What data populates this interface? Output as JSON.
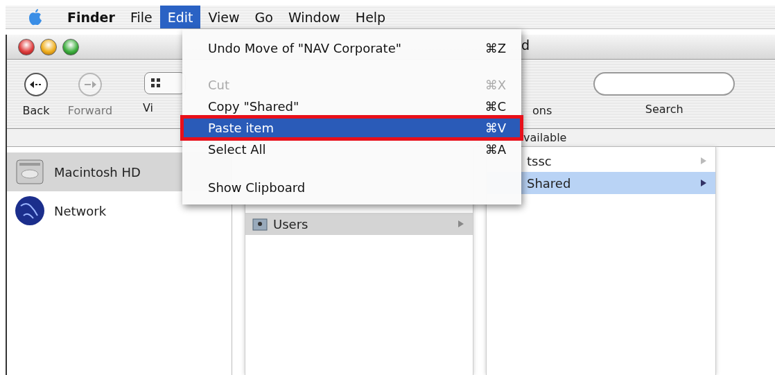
{
  "menu_bar": {
    "items": [
      {
        "label": "Finder",
        "selected": false
      },
      {
        "label": "File",
        "selected": false
      },
      {
        "label": "Edit",
        "selected": true
      },
      {
        "label": "View",
        "selected": false
      },
      {
        "label": "Go",
        "selected": false
      },
      {
        "label": "Window",
        "selected": false
      },
      {
        "label": "Help",
        "selected": false
      }
    ]
  },
  "window": {
    "title": "d"
  },
  "toolbar": {
    "items": [
      {
        "label": "Back",
        "disabled": false
      },
      {
        "label": "Forward",
        "disabled": true
      },
      {
        "label": "Vi",
        "disabled": false
      }
    ],
    "actions_label": "ons",
    "search": {
      "label": "Search"
    }
  },
  "path_bar": {
    "text": "vailable"
  },
  "sidebar": {
    "items": [
      {
        "label": "Macintosh HD",
        "kind": "disk",
        "selected": true
      },
      {
        "label": "Network",
        "kind": "globe",
        "selected": false
      }
    ]
  },
  "column_2": {
    "items": [
      {
        "label": "Users",
        "selected": true
      }
    ]
  },
  "column_3": {
    "items": [
      {
        "label": "tssc",
        "selected": false
      },
      {
        "label": "Shared",
        "selected": true
      }
    ]
  },
  "edit_menu": {
    "items": [
      {
        "kind": "item",
        "label": "Undo Move of \"NAV Corporate\"",
        "shortcut": "⌘Z",
        "disabled": false,
        "selected": false,
        "outlined": false
      },
      {
        "kind": "separator"
      },
      {
        "kind": "item",
        "label": "Cut",
        "shortcut": "⌘X",
        "disabled": true,
        "selected": false,
        "outlined": false
      },
      {
        "kind": "item",
        "label": "Copy \"Shared\"",
        "shortcut": "⌘C",
        "disabled": false,
        "selected": false,
        "outlined": false
      },
      {
        "kind": "item",
        "label": "Paste item",
        "shortcut": "⌘V",
        "disabled": false,
        "selected": true,
        "outlined": true
      },
      {
        "kind": "item",
        "label": "Select All",
        "shortcut": "⌘A",
        "disabled": false,
        "selected": false,
        "outlined": false
      },
      {
        "kind": "separator"
      },
      {
        "kind": "item",
        "label": "Show Clipboard",
        "disabled": false,
        "selected": false,
        "outlined": false
      }
    ]
  }
}
